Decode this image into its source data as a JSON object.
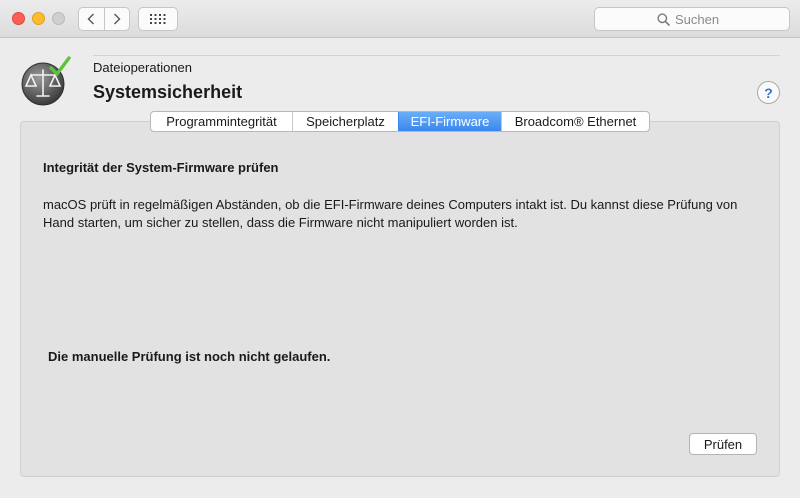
{
  "toolbar": {
    "back_icon": "chevron-left-icon",
    "forward_icon": "chevron-right-icon",
    "grid_icon": "grid-icon",
    "search": {
      "placeholder": "Suchen",
      "value": ""
    }
  },
  "header": {
    "category": "Dateioperationen",
    "title": "Systemsicherheit",
    "icon": "scales-check-icon",
    "help_label": "?"
  },
  "tabs": [
    {
      "label": "Programmintegrität",
      "active": false
    },
    {
      "label": "Speicherplatz",
      "active": false
    },
    {
      "label": "EFI-Firmware",
      "active": true
    },
    {
      "label": "Broadcom® Ethernet",
      "active": false
    }
  ],
  "content": {
    "section_title": "Integrität der System-Firmware prüfen",
    "description": "macOS prüft in regelmäßigen Abständen, ob die EFI-Firmware deines Computers intakt ist. Du kannst diese Prüfung von Hand starten, um sicher zu stellen, dass die Firmware nicht manipuliert worden ist.",
    "status": "Die manuelle Prüfung ist noch nicht gelaufen.",
    "check_button": "Prüfen"
  },
  "colors": {
    "accent": "#3a88ee",
    "close": "#fc5f57",
    "minimize": "#fdbc2e",
    "check_green": "#5cc43a"
  }
}
